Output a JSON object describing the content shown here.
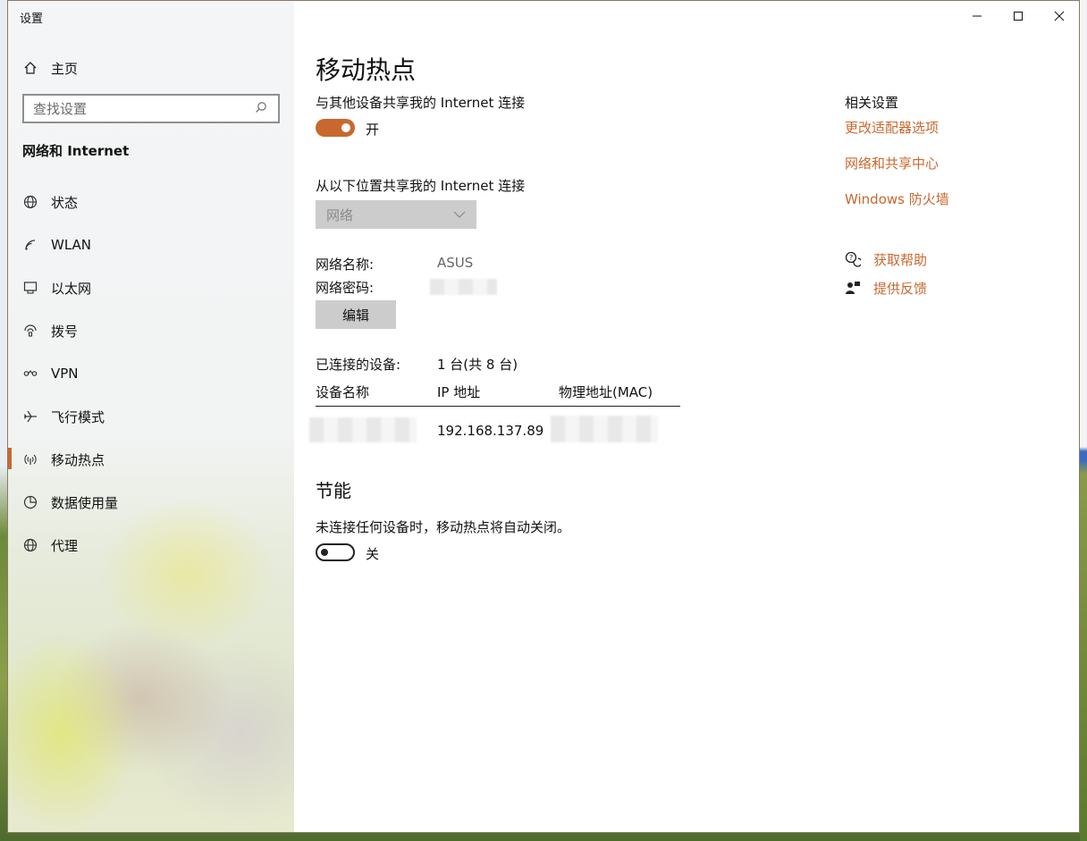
{
  "window": {
    "title": "设置",
    "controls": {
      "minimize": "—",
      "maximize": "☐",
      "close": "✕"
    }
  },
  "sidebar": {
    "home": {
      "label": "主页",
      "icon": "home-icon"
    },
    "search": {
      "placeholder": "查找设置",
      "icon": "search-icon"
    },
    "section": "网络和 Internet",
    "items": [
      {
        "label": "状态",
        "icon": "globe-status-icon"
      },
      {
        "label": "WLAN",
        "icon": "wifi-icon"
      },
      {
        "label": "以太网",
        "icon": "ethernet-icon"
      },
      {
        "label": "拨号",
        "icon": "dialup-icon"
      },
      {
        "label": "VPN",
        "icon": "vpn-icon"
      },
      {
        "label": "飞行模式",
        "icon": "airplane-icon"
      },
      {
        "label": "移动热点",
        "icon": "hotspot-icon",
        "active": true
      },
      {
        "label": "数据使用量",
        "icon": "data-usage-icon"
      },
      {
        "label": "代理",
        "icon": "globe-proxy-icon"
      }
    ]
  },
  "main": {
    "title": "移动热点",
    "share_label": "与其他设备共享我的 Internet 连接",
    "share_toggle": {
      "state": "on",
      "label": "开"
    },
    "share_from_label": "从以下位置共享我的 Internet 连接",
    "share_from_select": {
      "selected": "网络"
    },
    "network_name_label": "网络名称:",
    "network_name_value": "ASUS",
    "network_password_label": "网络密码:",
    "edit_button": "编辑",
    "connected_label": "已连接的设备:",
    "connected_value": "1 台(共 8 台)",
    "table": {
      "headers": [
        "设备名称",
        "IP 地址",
        "物理地址(MAC)"
      ],
      "rows": [
        {
          "ip": "192.168.137.89"
        }
      ]
    },
    "power_title": "节能",
    "power_desc": "未连接任何设备时，移动热点将自动关闭。",
    "power_toggle": {
      "state": "off",
      "label": "关"
    }
  },
  "related": {
    "title": "相关设置",
    "links": [
      "更改适配器选项",
      "网络和共享中心",
      "Windows 防火墙"
    ],
    "help": {
      "label": "获取帮助",
      "icon": "help-chat-icon"
    },
    "feedback": {
      "label": "提供反馈",
      "icon": "feedback-icon"
    }
  },
  "colors": {
    "accent": "#c8682f",
    "sidebar_bg": "#f2f4f4"
  }
}
